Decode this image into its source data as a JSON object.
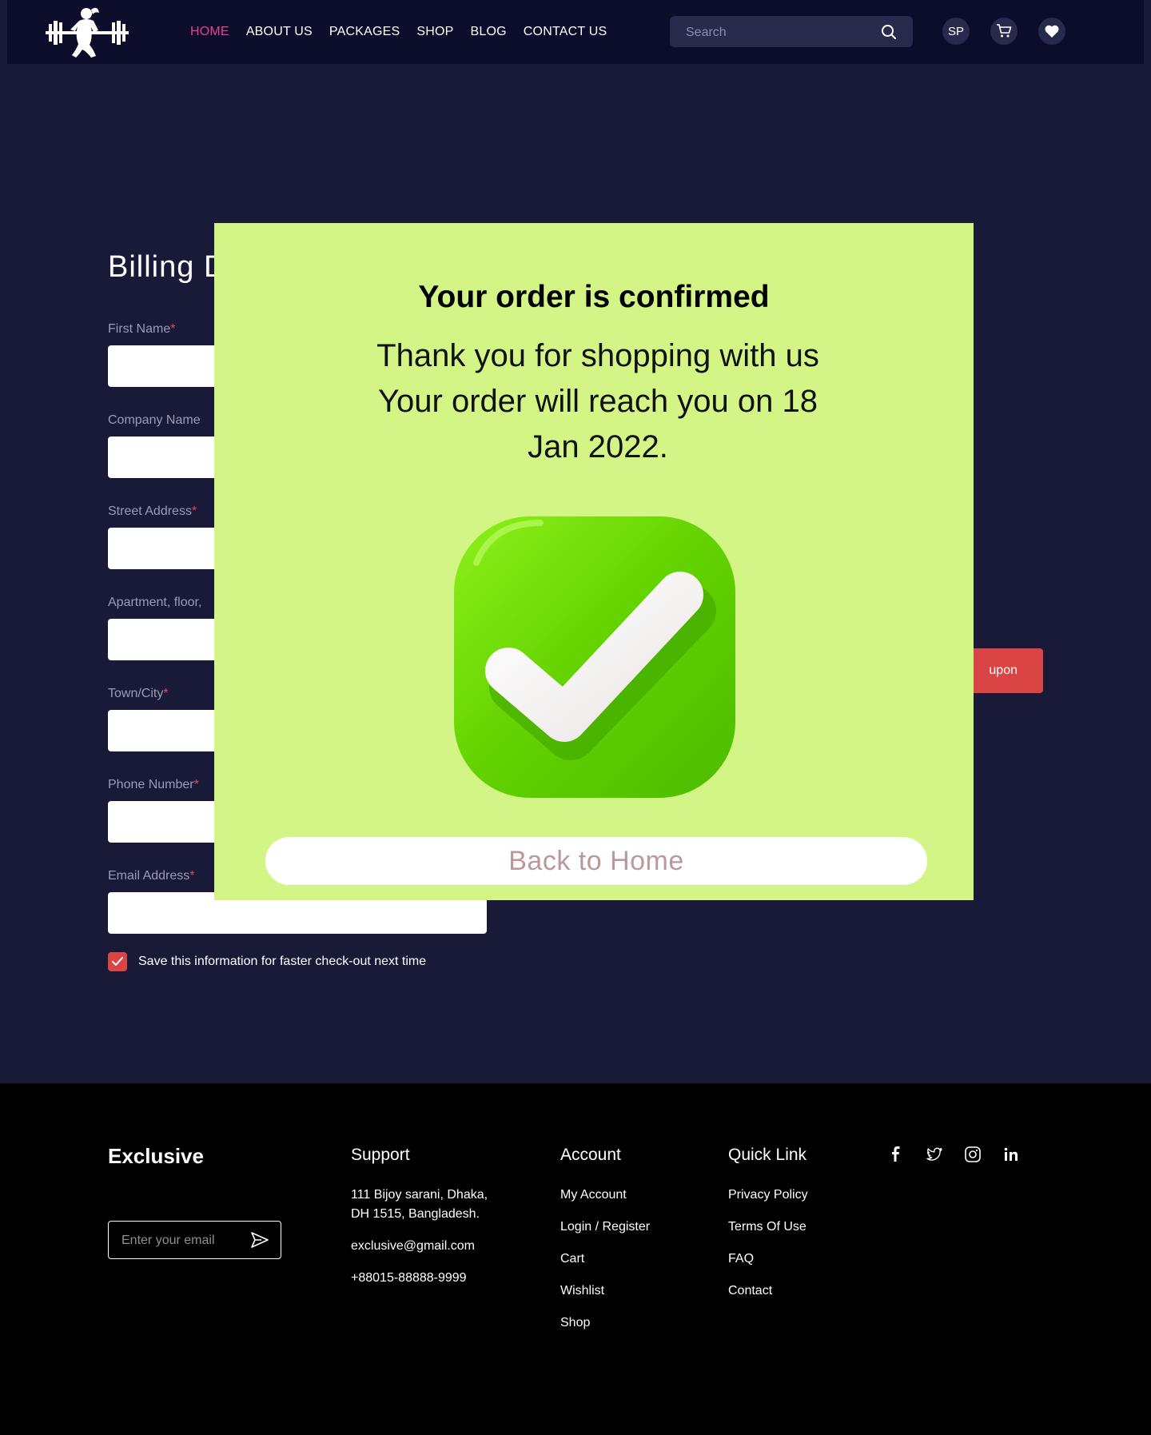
{
  "header": {
    "nav": [
      {
        "label": "HOME",
        "active": true
      },
      {
        "label": "ABOUT US"
      },
      {
        "label": "PACKAGES"
      },
      {
        "label": "SHOP"
      },
      {
        "label": "BLOG"
      },
      {
        "label": "CONTACT US"
      }
    ],
    "search_placeholder": "Search",
    "user_initials": "SP",
    "icons": [
      "search-icon",
      "cart-icon",
      "heart-icon"
    ]
  },
  "billing": {
    "title": "Billing D",
    "fields": [
      {
        "label": "First Name",
        "required": true
      },
      {
        "label": "Company Name",
        "required": false
      },
      {
        "label": "Street Address",
        "required": true
      },
      {
        "label": "Apartment, floor,",
        "required": false
      },
      {
        "label": "Town/City",
        "required": true
      },
      {
        "label": "Phone Number",
        "required": true
      },
      {
        "label": "Email Address",
        "required": true
      }
    ],
    "save_info_label": "Save this information for faster check-out next time",
    "save_info_checked": true,
    "coupon_button_label": "upon"
  },
  "modal": {
    "title": "Your order is confirmed",
    "line1": "Thank you for shopping with us",
    "line2": "Your order will reach you on 18 Jan 2022.",
    "back_button_label": "Back to Home",
    "background_color": "#d3f585",
    "check_color": "#5fd300"
  },
  "footer": {
    "brand": "Exclusive",
    "email_placeholder": "Enter your email",
    "support": {
      "heading": "Support",
      "address": "111 Bijoy sarani, Dhaka, DH 1515, Bangladesh.",
      "email": "exclusive@gmail.com",
      "phone": "+88015-88888-9999"
    },
    "account": {
      "heading": "Account",
      "links": [
        "My Account",
        "Login / Register",
        "Cart",
        "Wishlist",
        "Shop"
      ]
    },
    "quick_link": {
      "heading": "Quick Link",
      "links": [
        "Privacy Policy",
        "Terms Of Use",
        "FAQ",
        "Contact"
      ]
    },
    "socials": [
      "facebook-icon",
      "twitter-icon",
      "instagram-icon",
      "linkedin-icon"
    ]
  },
  "colors": {
    "page_bg": "#181a38",
    "header_bg": "#0b0d2b",
    "accent_pink": "#e9418a",
    "accent_red": "#db4444"
  }
}
